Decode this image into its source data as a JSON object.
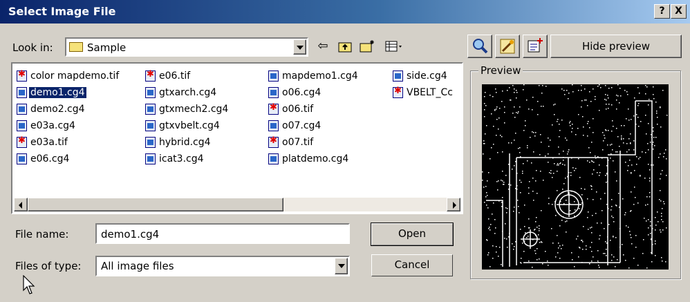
{
  "window": {
    "title": "Select Image File",
    "help_label": "?",
    "close_label": "X"
  },
  "look_in": {
    "label": "Look in:",
    "value": "Sample"
  },
  "preview_tools": {
    "hide_preview_label": "Hide preview"
  },
  "files": {
    "columns": [
      [
        {
          "name": "color mapdemo.tif",
          "type": "tif"
        },
        {
          "name": "demo1.cg4",
          "type": "cg4",
          "selected": true
        },
        {
          "name": "demo2.cg4",
          "type": "cg4"
        },
        {
          "name": "e03a.cg4",
          "type": "cg4"
        },
        {
          "name": "e03a.tif",
          "type": "tif"
        },
        {
          "name": "e06.cg4",
          "type": "cg4"
        }
      ],
      [
        {
          "name": "e06.tif",
          "type": "tif"
        },
        {
          "name": "gtxarch.cg4",
          "type": "cg4"
        },
        {
          "name": "gtxmech2.cg4",
          "type": "cg4"
        },
        {
          "name": "gtxvbelt.cg4",
          "type": "cg4"
        },
        {
          "name": "hybrid.cg4",
          "type": "cg4"
        },
        {
          "name": "icat3.cg4",
          "type": "cg4"
        }
      ],
      [
        {
          "name": "mapdemo1.cg4",
          "type": "cg4"
        },
        {
          "name": "o06.cg4",
          "type": "cg4"
        },
        {
          "name": "o06.tif",
          "type": "tif"
        },
        {
          "name": "o07.cg4",
          "type": "cg4"
        },
        {
          "name": "o07.tif",
          "type": "tif"
        },
        {
          "name": "platdemo.cg4",
          "type": "cg4"
        }
      ],
      [
        {
          "name": "side.cg4",
          "type": "cg4"
        },
        {
          "name": "VBELT_Cc",
          "type": "tif"
        }
      ]
    ]
  },
  "file_name": {
    "label": "File name:",
    "value": "demo1.cg4"
  },
  "files_of_type": {
    "label": "Files of type:",
    "value": "All image files"
  },
  "buttons": {
    "open": "Open",
    "cancel": "Cancel"
  },
  "preview": {
    "title": "Preview"
  },
  "colors": {
    "title_start": "#0a246a",
    "title_end": "#a6caf0",
    "selection": "#0a246a",
    "face": "#d4d0c8"
  }
}
